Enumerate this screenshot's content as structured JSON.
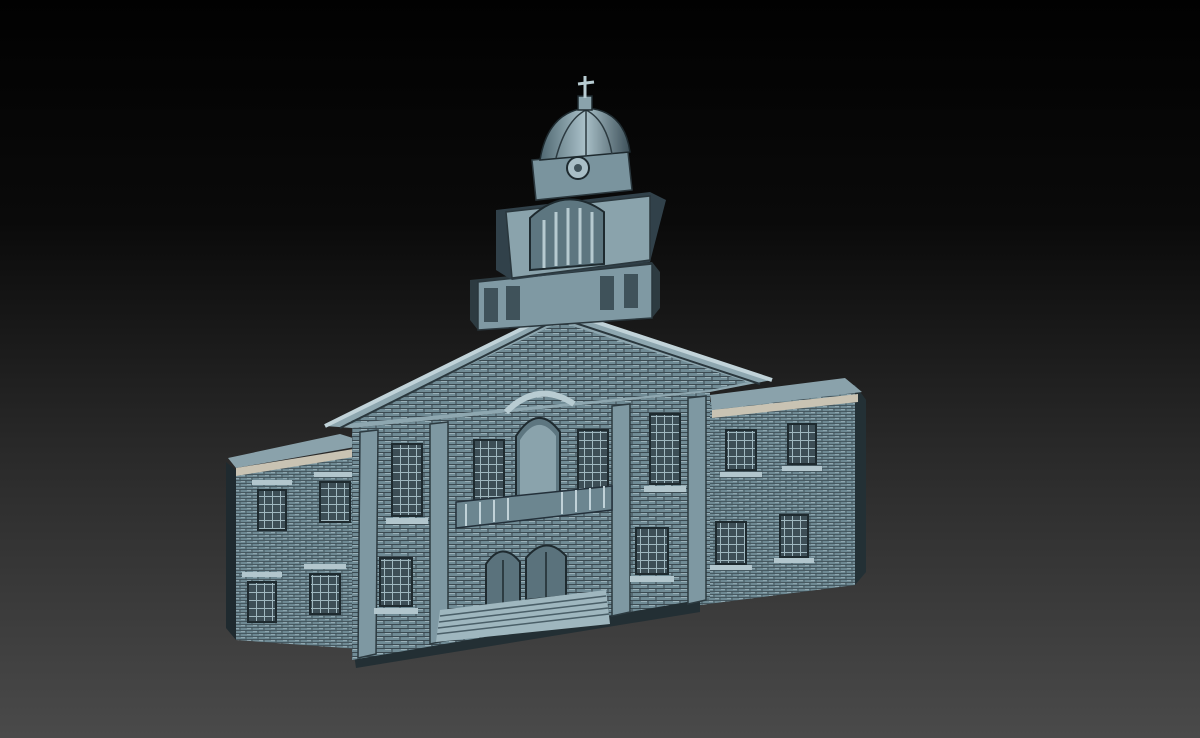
{
  "scene": {
    "subject": "building-relief-model",
    "colors": {
      "background_top": "#010101",
      "background_bottom": "#4a4a4a",
      "material_light": "#9fb7bf",
      "material_mid": "#6f8a94",
      "material_dark": "#2f3d44",
      "material_shadow": "#1a2328",
      "cornice_highlight": "#c9c3b3"
    }
  }
}
